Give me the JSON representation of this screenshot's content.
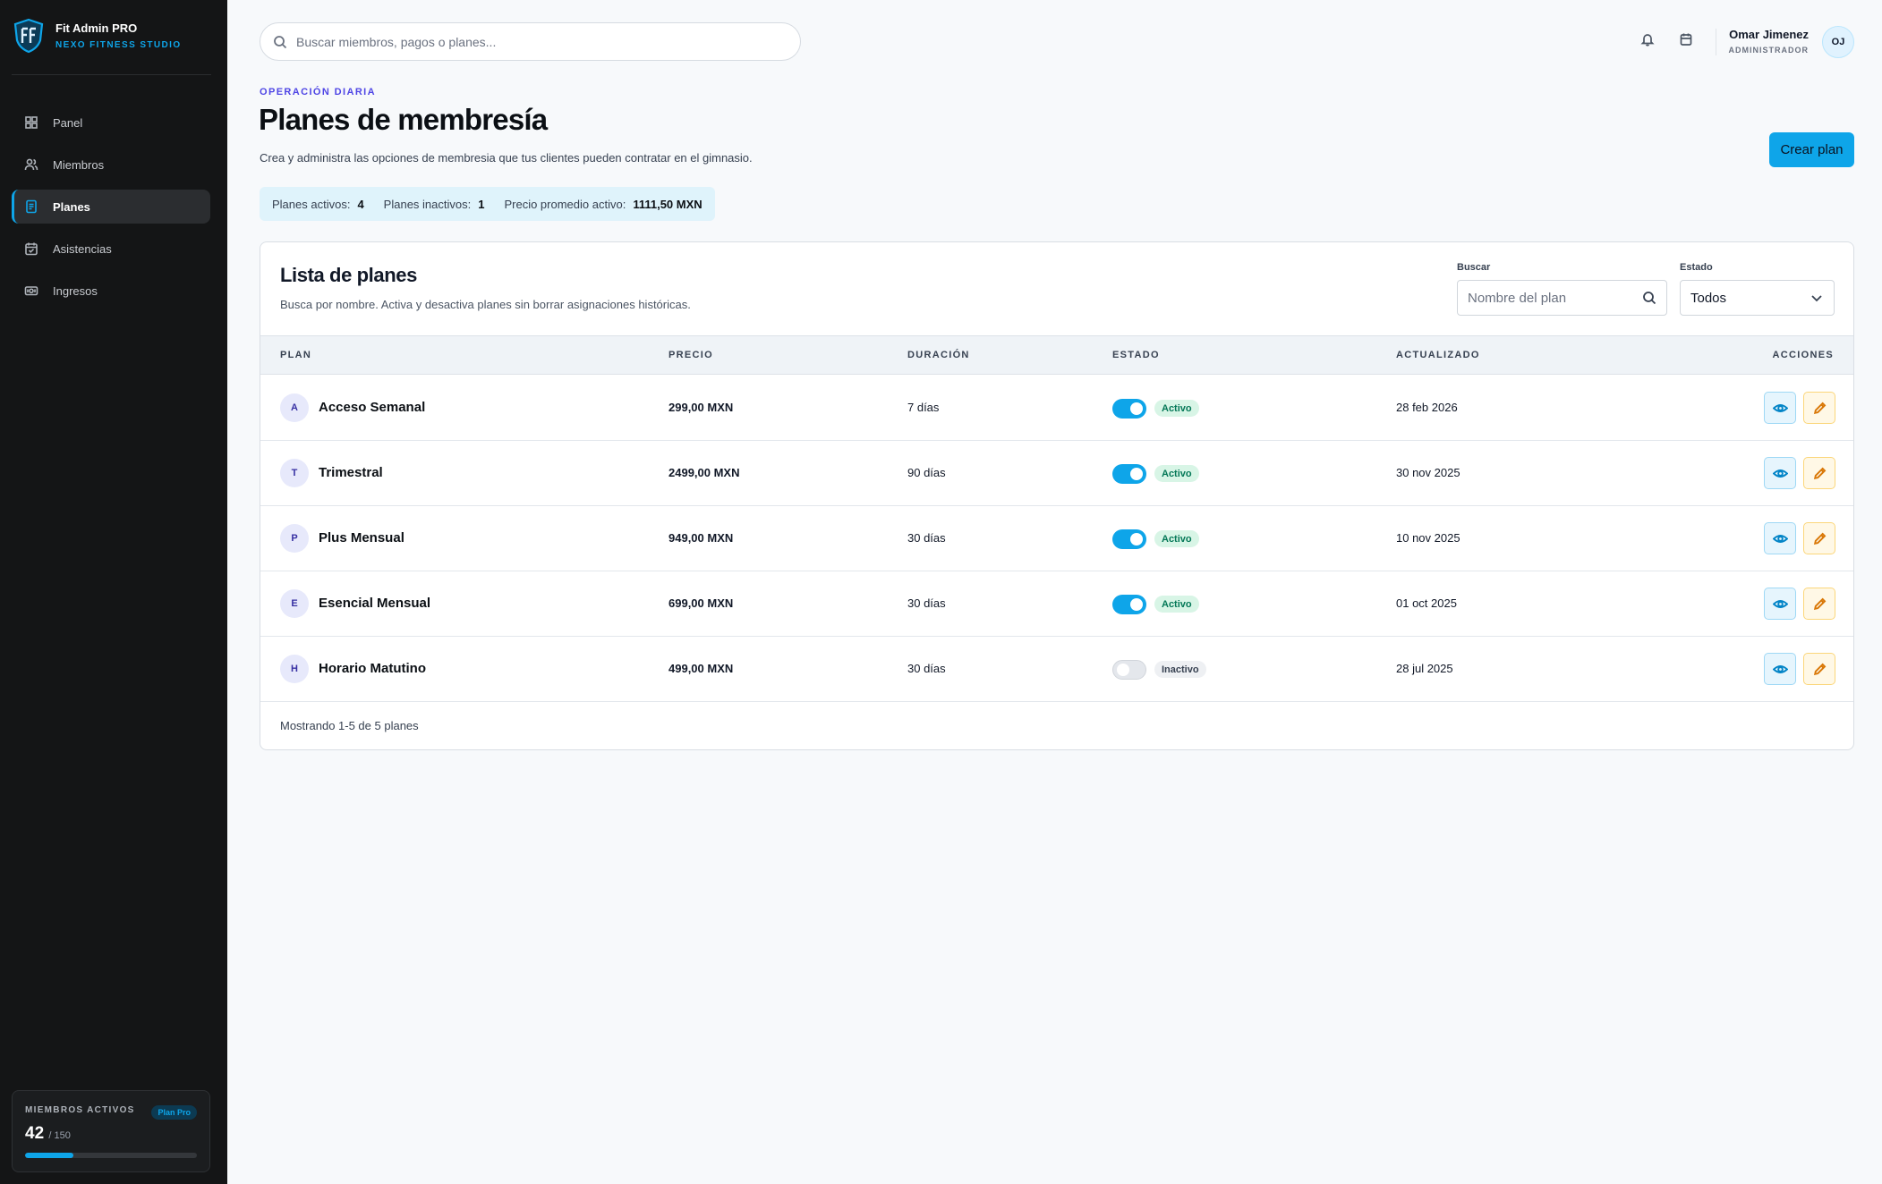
{
  "brand": {
    "name": "Fit Admin PRO",
    "studio": "NEXO FITNESS STUDIO"
  },
  "nav": [
    {
      "label": "Panel",
      "icon": "grid-icon",
      "active": false
    },
    {
      "label": "Miembros",
      "icon": "users-icon",
      "active": false
    },
    {
      "label": "Planes",
      "icon": "document-icon",
      "active": true
    },
    {
      "label": "Asistencias",
      "icon": "calendar-check-icon",
      "active": false
    },
    {
      "label": "Ingresos",
      "icon": "money-icon",
      "active": false
    }
  ],
  "members_card": {
    "title": "MIEMBROS ACTIVOS",
    "badge": "Plan Pro",
    "count": "42",
    "total": "/ 150",
    "progress": 0.28
  },
  "topbar": {
    "search_placeholder": "Buscar miembros, pagos o planes...",
    "user_name": "Omar Jimenez",
    "user_role": "ADMINISTRADOR",
    "user_initials": "OJ"
  },
  "header": {
    "eyebrow": "OPERACIÓN DIARIA",
    "title": "Planes de membresía",
    "description": "Crea y administra las opciones de membresia que tus clientes pueden contratar en el gimnasio.",
    "create_button": "Crear plan"
  },
  "stats": {
    "active_label": "Planes activos:",
    "active_value": "4",
    "inactive_label": "Planes inactivos:",
    "inactive_value": "1",
    "avg_label": "Precio promedio activo:",
    "avg_value": "1111,50 MXN"
  },
  "card": {
    "title": "Lista de planes",
    "subtitle": "Busca por nombre. Activa y desactiva planes sin borrar asignaciones históricas.",
    "search_label": "Buscar",
    "search_placeholder": "Nombre del plan",
    "status_label": "Estado",
    "status_value": "Todos",
    "footer": "Mostrando 1-5 de 5 planes"
  },
  "table": {
    "columns": [
      "PLAN",
      "PRECIO",
      "DURACIÓN",
      "ESTADO",
      "ACTUALIZADO",
      "ACCIONES"
    ],
    "rows": [
      {
        "initial": "A",
        "name": "Acceso Semanal",
        "price": "299,00 MXN",
        "duration": "7 días",
        "active": true,
        "status": "Activo",
        "updated": "28 feb 2026"
      },
      {
        "initial": "T",
        "name": "Trimestral",
        "price": "2499,00 MXN",
        "duration": "90 días",
        "active": true,
        "status": "Activo",
        "updated": "30 nov 2025"
      },
      {
        "initial": "P",
        "name": "Plus Mensual",
        "price": "949,00 MXN",
        "duration": "30 días",
        "active": true,
        "status": "Activo",
        "updated": "10 nov 2025"
      },
      {
        "initial": "E",
        "name": "Esencial Mensual",
        "price": "699,00 MXN",
        "duration": "30 días",
        "active": true,
        "status": "Activo",
        "updated": "01 oct 2025"
      },
      {
        "initial": "H",
        "name": "Horario Matutino",
        "price": "499,00 MXN",
        "duration": "30 días",
        "active": false,
        "status": "Inactivo",
        "updated": "28 jul 2025"
      }
    ]
  },
  "colors": {
    "accent": "#0ea5e9",
    "sidebar": "#141516",
    "eyebrow": "#4f46e5"
  }
}
